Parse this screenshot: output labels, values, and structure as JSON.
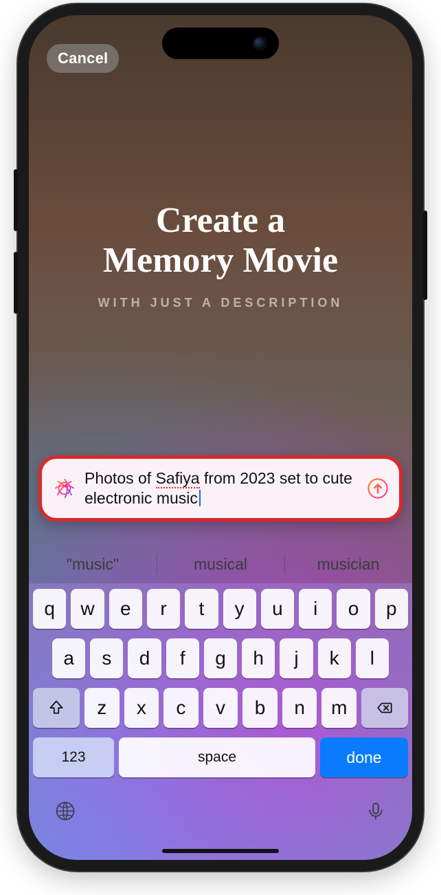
{
  "header": {
    "cancel_label": "Cancel",
    "title_line1": "Create a",
    "title_line2": "Memory Movie",
    "subtitle": "WITH JUST A DESCRIPTION"
  },
  "prompt": {
    "text_pre": "Photos of ",
    "misspelled": "Safiya",
    "text_post": " from 2023 set to cute electronic music",
    "ai_icon": "apple-intelligence-icon",
    "send_icon": "submit-arrow-icon"
  },
  "suggestions": [
    "\"music\"",
    "musical",
    "musician"
  ],
  "keyboard": {
    "row1": [
      "q",
      "w",
      "e",
      "r",
      "t",
      "y",
      "u",
      "i",
      "o",
      "p"
    ],
    "row2": [
      "a",
      "s",
      "d",
      "f",
      "g",
      "h",
      "j",
      "k",
      "l"
    ],
    "row3": [
      "z",
      "x",
      "c",
      "v",
      "b",
      "n",
      "m"
    ],
    "numbers_label": "123",
    "space_label": "space",
    "done_label": "done"
  }
}
